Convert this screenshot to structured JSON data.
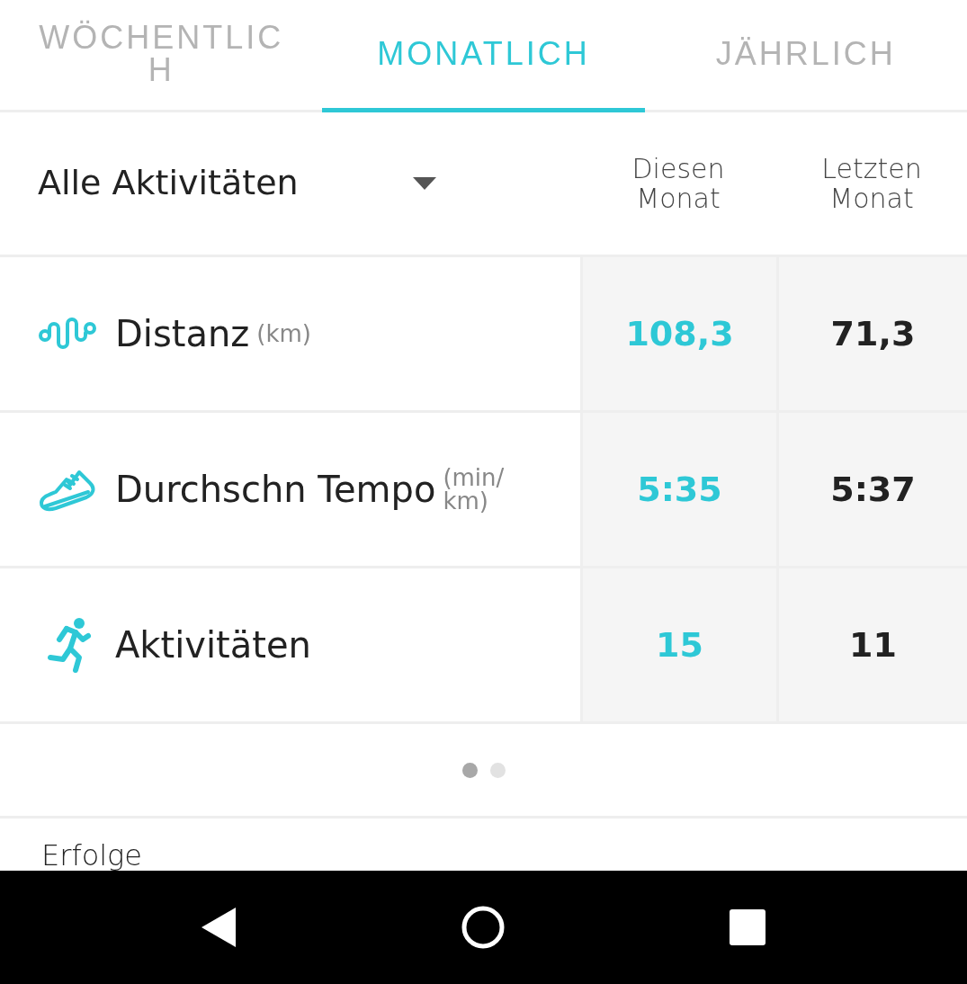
{
  "tabs": [
    {
      "label": "WÖCHENTLICH",
      "selected": false
    },
    {
      "label": "MONATLICH",
      "selected": true
    },
    {
      "label": "JÄHRLICH",
      "selected": false
    }
  ],
  "filter": {
    "label": "Alle Aktivitäten"
  },
  "columns": [
    "Diesen Monat",
    "Letzten Monat"
  ],
  "rows": [
    {
      "kind": "distance",
      "label": "Distanz",
      "unit": "(km)",
      "this_month": "108,3",
      "last_month": "71,3"
    },
    {
      "kind": "pace",
      "label": "Durchschn Tempo",
      "unit": "(min/ km)",
      "this_month": "5:35",
      "last_month": "5:37"
    },
    {
      "kind": "activities",
      "label": "Aktivitäten",
      "this_month": "15",
      "last_month": "11"
    }
  ],
  "pager": [
    {
      "selected": true
    },
    {
      "selected": false
    }
  ],
  "section_title": "Erfolge"
}
